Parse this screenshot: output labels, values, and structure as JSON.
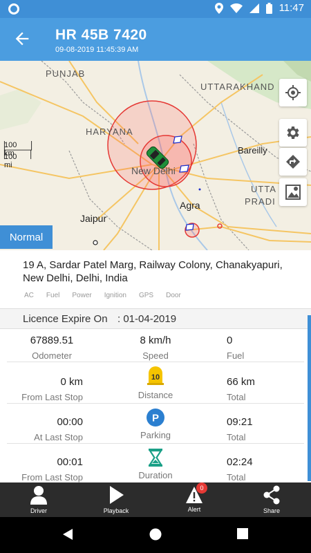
{
  "status_bar": {
    "time": "11:47"
  },
  "header": {
    "title": "HR 45B 7420",
    "subtitle": "09-08-2019 11:45:39 AM"
  },
  "map": {
    "labels": {
      "punjab": "PUNJAB",
      "uttarakhand": "UTTARAKHAND",
      "haryana": "HARYANA",
      "new_delhi": "New Delhi",
      "bareilly": "Bareilly",
      "agra": "Agra",
      "jaipur": "Jaipur",
      "utta": "UTTA",
      "pradi": "PRADI"
    },
    "scale": {
      "km": "100 km",
      "mi": "100 mi"
    },
    "mode_badge": "Normal"
  },
  "address": "19 A, Sardar Patel Marg, Railway Colony, Chanakyapuri, New Delhi, Delhi,  India",
  "sensors": [
    "AC",
    "Fuel",
    "Power",
    "Ignition",
    "GPS",
    "Door"
  ],
  "licence": {
    "label": "Licence Expire On",
    "value": ": 01-04-2019"
  },
  "stats": {
    "odometer": {
      "value": "67889.51",
      "label": "Odometer"
    },
    "speed": {
      "value": "8 km/h",
      "label": "Speed"
    },
    "fuel": {
      "value": "0",
      "label": "Fuel"
    },
    "distance_from_stop": {
      "value": "0 km",
      "label": "From Last Stop"
    },
    "distance": {
      "label": "Distance",
      "icon_text": "10"
    },
    "distance_total": {
      "value": "66 km",
      "label": "Total"
    },
    "parking_last": {
      "value": "00:00",
      "label": "At Last Stop"
    },
    "parking": {
      "label": "Parking",
      "icon_text": "P"
    },
    "parking_total": {
      "value": "09:21",
      "label": "Total"
    },
    "duration_from_stop": {
      "value": "00:01",
      "label": "From Last Stop"
    },
    "duration": {
      "label": "Duration"
    },
    "duration_total": {
      "value": "02:24",
      "label": "Total"
    }
  },
  "bottom_nav": {
    "driver": "Driver",
    "playback": "Playback",
    "alert": "Alert",
    "alert_count": "0",
    "share": "Share"
  },
  "colors": {
    "primary": "#4b9de0",
    "status": "#3f8fd6",
    "nav_bg": "#2c2c2c",
    "icon_blue": "#2b7fd0",
    "icon_yellow": "#f5c400",
    "icon_teal": "#1aa087"
  }
}
